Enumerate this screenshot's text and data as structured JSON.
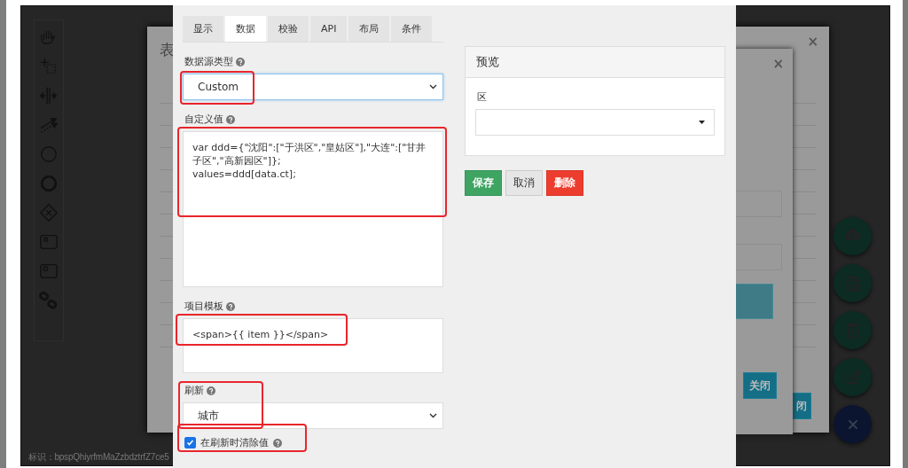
{
  "background_dialog": {
    "title": "表",
    "close": "×",
    "partial_button": "闭"
  },
  "inner_dialog": {
    "close": "×",
    "close_button": "关闭"
  },
  "footer": {
    "id_text": "标识：bpspQhiyrfmMaZzbdztrfZ7ce5"
  },
  "editor": {
    "tabs": [
      {
        "label": "显示",
        "selected": false
      },
      {
        "label": "数据",
        "selected": true
      },
      {
        "label": "校验",
        "selected": false
      },
      {
        "label": "API",
        "selected": false
      },
      {
        "label": "布局",
        "selected": false
      },
      {
        "label": "条件",
        "selected": false
      }
    ],
    "fields": [
      {
        "kind": "select",
        "label": "数据源类型",
        "value": "Custom",
        "focused": true,
        "highlighted": true
      },
      {
        "kind": "textarea",
        "label": "自定义值",
        "value": "var ddd={\"沈阳\":[\"于洪区\",\"皇姑区\"],\"大连\":[\"甘井子区\",\"高新园区\"]};\nvalues=ddd[data.ct];",
        "highlighted": true
      },
      {
        "kind": "template",
        "label": "项目模板",
        "value": "<span>{{ item }}</span>",
        "highlighted": true
      },
      {
        "kind": "select",
        "label": "刷新",
        "value": "城市",
        "focused": false,
        "highlighted": true
      },
      {
        "kind": "checkbox",
        "label": "在刷新时清除值",
        "checked": true,
        "highlighted": true
      }
    ],
    "preview": {
      "title": "预览",
      "field_label": "区"
    },
    "buttons": [
      {
        "label": "保存",
        "kind": "success"
      },
      {
        "label": "取消",
        "kind": "default"
      },
      {
        "label": "删除",
        "kind": "danger"
      }
    ]
  }
}
